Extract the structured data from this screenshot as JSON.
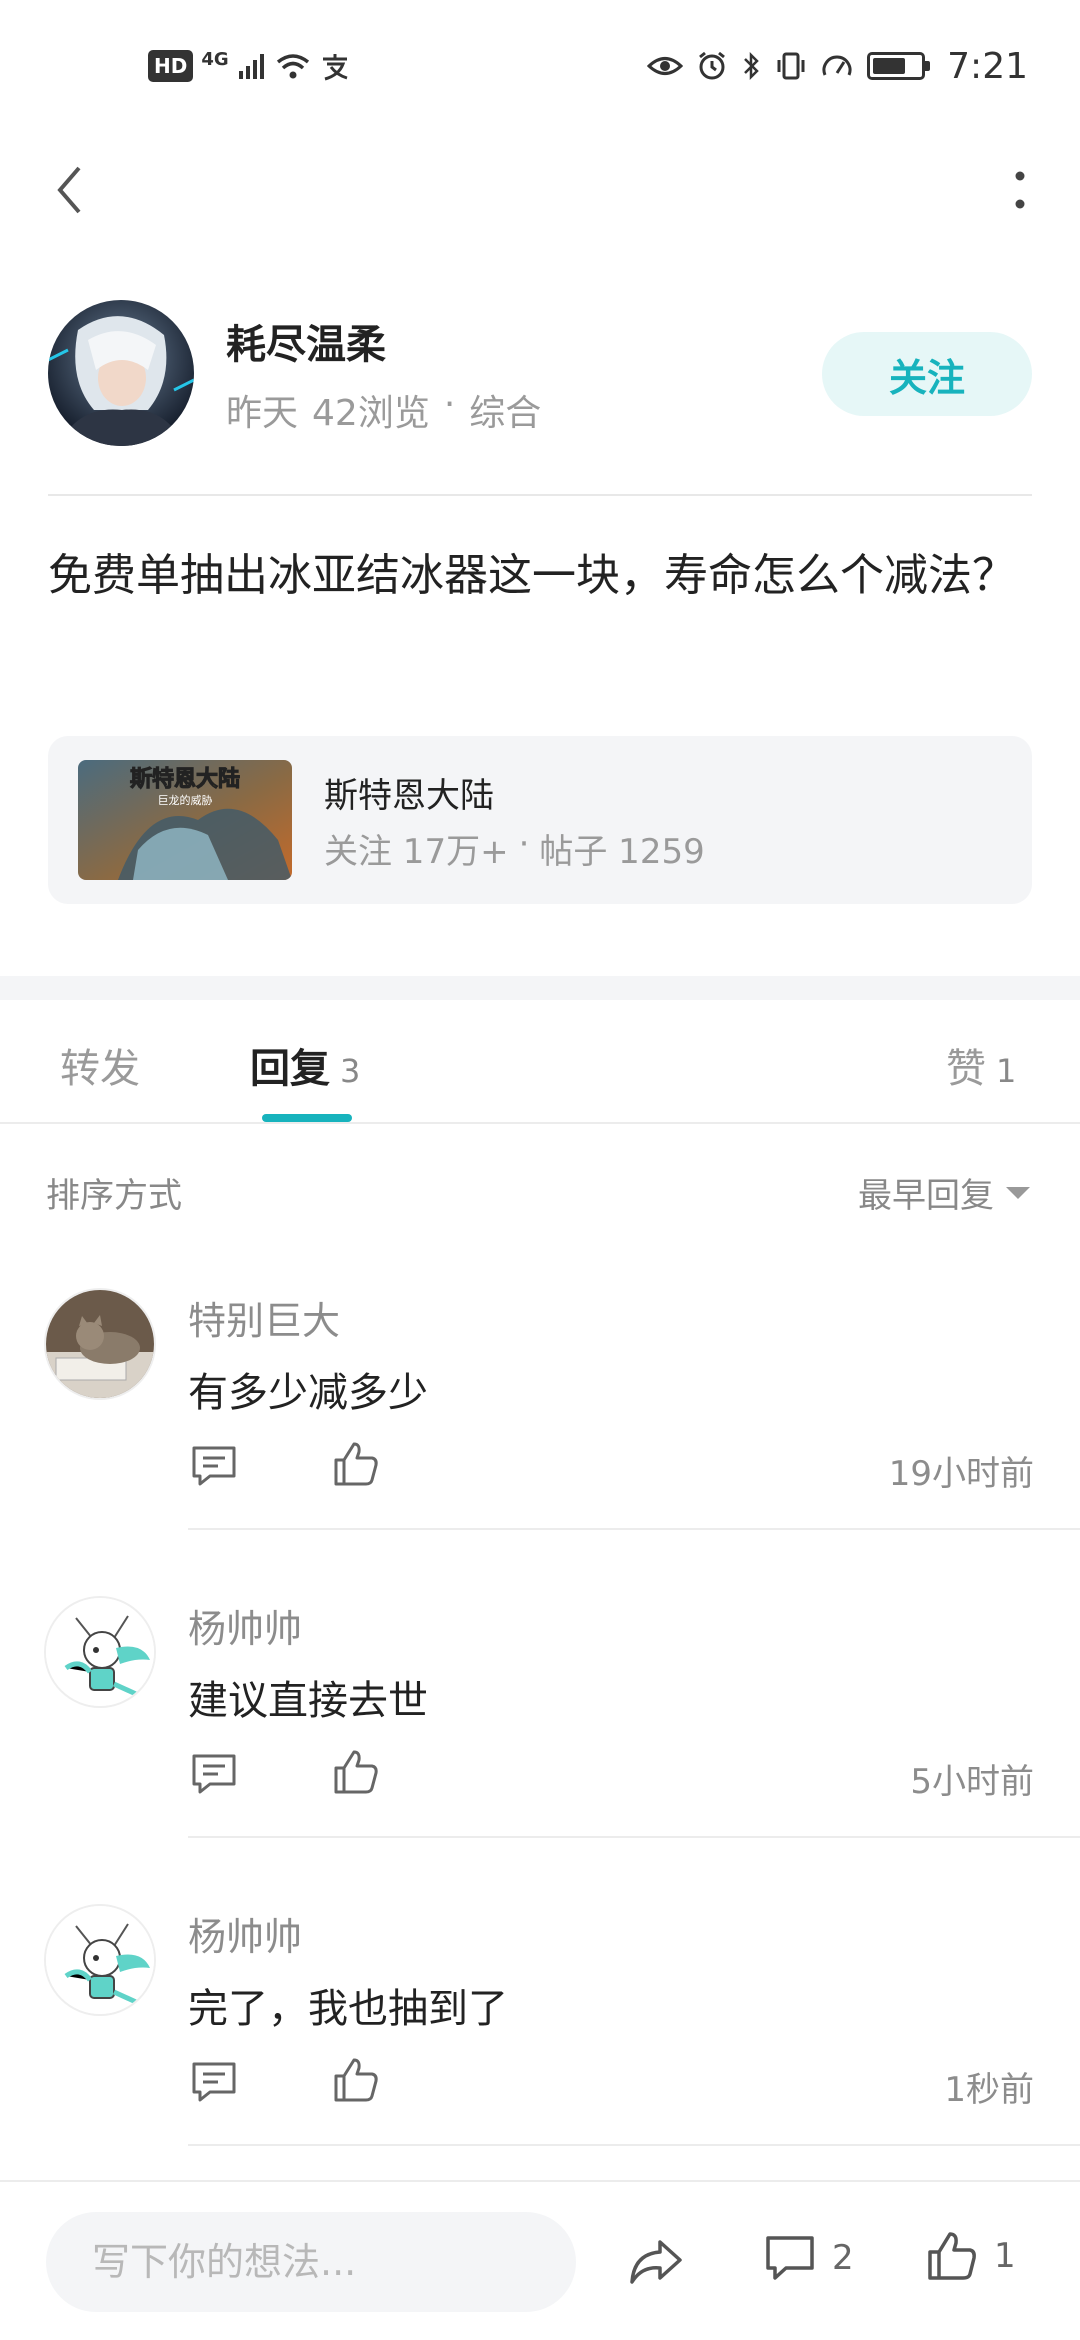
{
  "status_bar": {
    "hd": "HD",
    "network": "4G",
    "time": "7:21",
    "battery_level": 0.7,
    "icons": [
      "signal-icon",
      "wifi-icon",
      "alipay-icon",
      "eye-icon",
      "alarm-icon",
      "bluetooth-icon",
      "vibrate-icon",
      "speed-icon",
      "battery-icon"
    ]
  },
  "topbar": {
    "back_icon": "chevron-left-icon",
    "more_icon": "more-vertical-icon"
  },
  "author": {
    "name": "耗尽温柔",
    "time": "昨天",
    "views": "42浏览",
    "separator": "·",
    "category": "综合",
    "follow_label": "关注"
  },
  "post": {
    "title": "免费单抽出冰亚结冰器这一块，寿命怎么个减法？"
  },
  "forum": {
    "thumb_title": "斯特恩大陆",
    "thumb_subtitle": "巨龙的威胁",
    "name": "斯特恩大陆",
    "followers": "关注 17万+",
    "separator": "·",
    "posts": "帖子 1259"
  },
  "tabs": [
    {
      "label": "转发",
      "count": ""
    },
    {
      "label": "回复",
      "count": "3"
    },
    {
      "label": "赞",
      "count": "1"
    }
  ],
  "sort": {
    "label": "排序方式",
    "value": "最早回复"
  },
  "comments": [
    {
      "name": "特别巨大",
      "text": "有多少减多少",
      "time": "19小时前"
    },
    {
      "name": "杨帅帅",
      "text": "建议直接去世",
      "time": "5小时前"
    },
    {
      "name": "杨帅帅",
      "text": "完了，我也抽到了",
      "time": "1秒前"
    }
  ],
  "bottom": {
    "input_placeholder": "写下你的想法...",
    "comment_count": "2",
    "like_count": "1"
  },
  "colors": {
    "accent": "#17b3bd",
    "follow_bg": "#e6f7f7",
    "card_bg": "#f4f5f7"
  }
}
